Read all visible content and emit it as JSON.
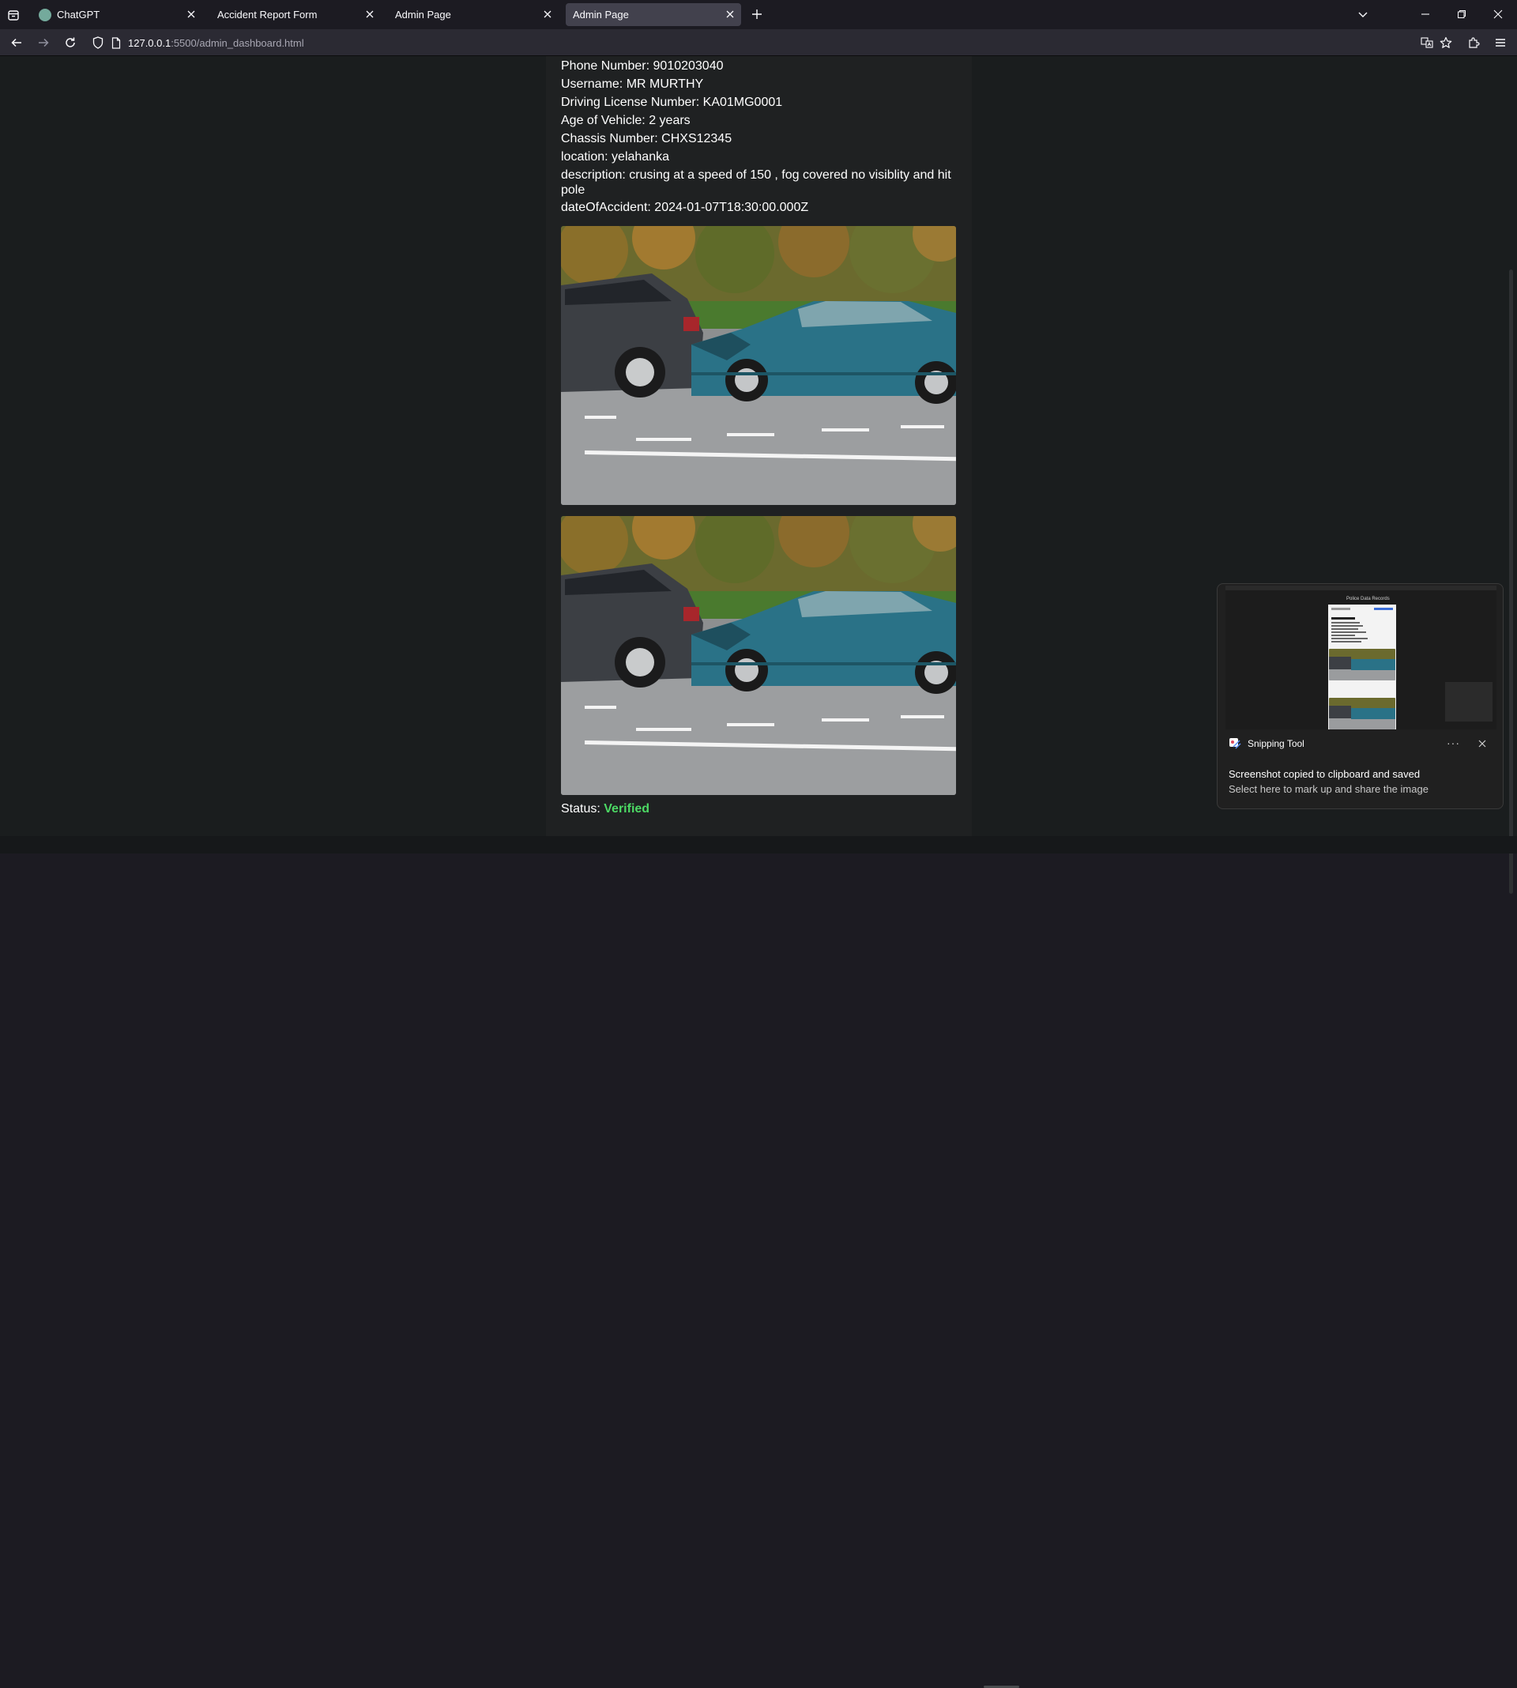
{
  "browser": {
    "tabs": [
      {
        "title": "ChatGPT",
        "active": false
      },
      {
        "title": "Accident Report Form",
        "active": false
      },
      {
        "title": "Admin Page",
        "active": false
      },
      {
        "title": "Admin Page",
        "active": true
      }
    ],
    "url_host": "127.0.0.1",
    "url_path": ":5500/admin_dashboard.html"
  },
  "report": {
    "lines": [
      {
        "label": "Phone Number:",
        "value": "9010203040"
      },
      {
        "label": "Username:",
        "value": "MR MURTHY"
      },
      {
        "label": "Driving License Number:",
        "value": "KA01MG0001"
      },
      {
        "label": "Age of Vehicle:",
        "value": "2 years"
      },
      {
        "label": "Chassis Number:",
        "value": "CHXS12345"
      },
      {
        "label": "location:",
        "value": "yelahanka"
      },
      {
        "label": "description:",
        "value": "crusing at a speed of 150 , fog covered no visiblity and hit pole"
      },
      {
        "label": "dateOfAccident:",
        "value": "2024-01-07T18:30:00.000Z"
      }
    ],
    "status_label": "Status:",
    "status_value": "Verified",
    "status_color": "#4cd964"
  },
  "snipping_tool": {
    "app_name": "Snipping Tool",
    "more": "···",
    "message": "Screenshot copied to clipboard and saved",
    "sub_message": "Select here to mark up and share the image",
    "thumbnail_title": "Police Data Records"
  },
  "icons": {
    "tab_list": "tab-list-icon",
    "back": "back-arrow-icon",
    "forward": "forward-arrow-icon",
    "reload": "reload-icon",
    "shield": "shield-icon",
    "page": "page-icon",
    "translate": "translate-icon",
    "bookmark": "star-icon",
    "extensions": "puzzle-icon",
    "menu": "hamburger-menu-icon"
  }
}
